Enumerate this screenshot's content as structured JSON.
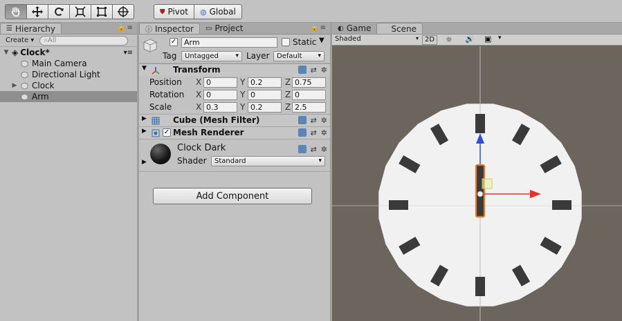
{
  "toolbar": {
    "pivot_label": "Pivot",
    "global_label": "Global",
    "tools": [
      "hand-icon",
      "move-icon",
      "rotate-icon",
      "scale-icon",
      "rect-icon",
      "transform-icon"
    ]
  },
  "hierarchy": {
    "tab_label": "Hierarchy",
    "create_label": "Create",
    "search_placeholder": "All",
    "scene_name": "Clock*",
    "items": [
      {
        "label": "Main Camera"
      },
      {
        "label": "Directional Light"
      },
      {
        "label": "Clock"
      },
      {
        "label": "Arm"
      }
    ]
  },
  "inspector": {
    "tab_label": "Inspector",
    "project_tab_label": "Project",
    "object_name": "Arm",
    "static_label": "Static",
    "tag_label": "Tag",
    "tag_value": "Untagged",
    "layer_label": "Layer",
    "layer_value": "Default",
    "transform": {
      "title": "Transform",
      "position_label": "Position",
      "rotation_label": "Rotation",
      "scale_label": "Scale",
      "x": "X",
      "y": "Y",
      "z": "Z",
      "position": [
        "0",
        "0.2",
        "0.75"
      ],
      "rotation": [
        "0",
        "0",
        "0"
      ],
      "scale": [
        "0.3",
        "0.2",
        "2.5"
      ]
    },
    "mesh_filter_title": "Cube (Mesh Filter)",
    "mesh_renderer_title": "Mesh Renderer",
    "material_name": "Clock Dark",
    "shader_label": "Shader",
    "shader_value": "Standard",
    "add_component_label": "Add Component"
  },
  "scene": {
    "game_tab_label": "Game",
    "scene_tab_label": "Scene",
    "shading_mode": "Shaded",
    "mode_2d": "2D",
    "colors": {
      "background": "#6b655d",
      "clock_face": "#f1f1f1",
      "marks": "#3a3a3a",
      "selection": "#f07a1a",
      "x_axis": "#e8302a",
      "y_axis": "#2a4fe8"
    }
  }
}
